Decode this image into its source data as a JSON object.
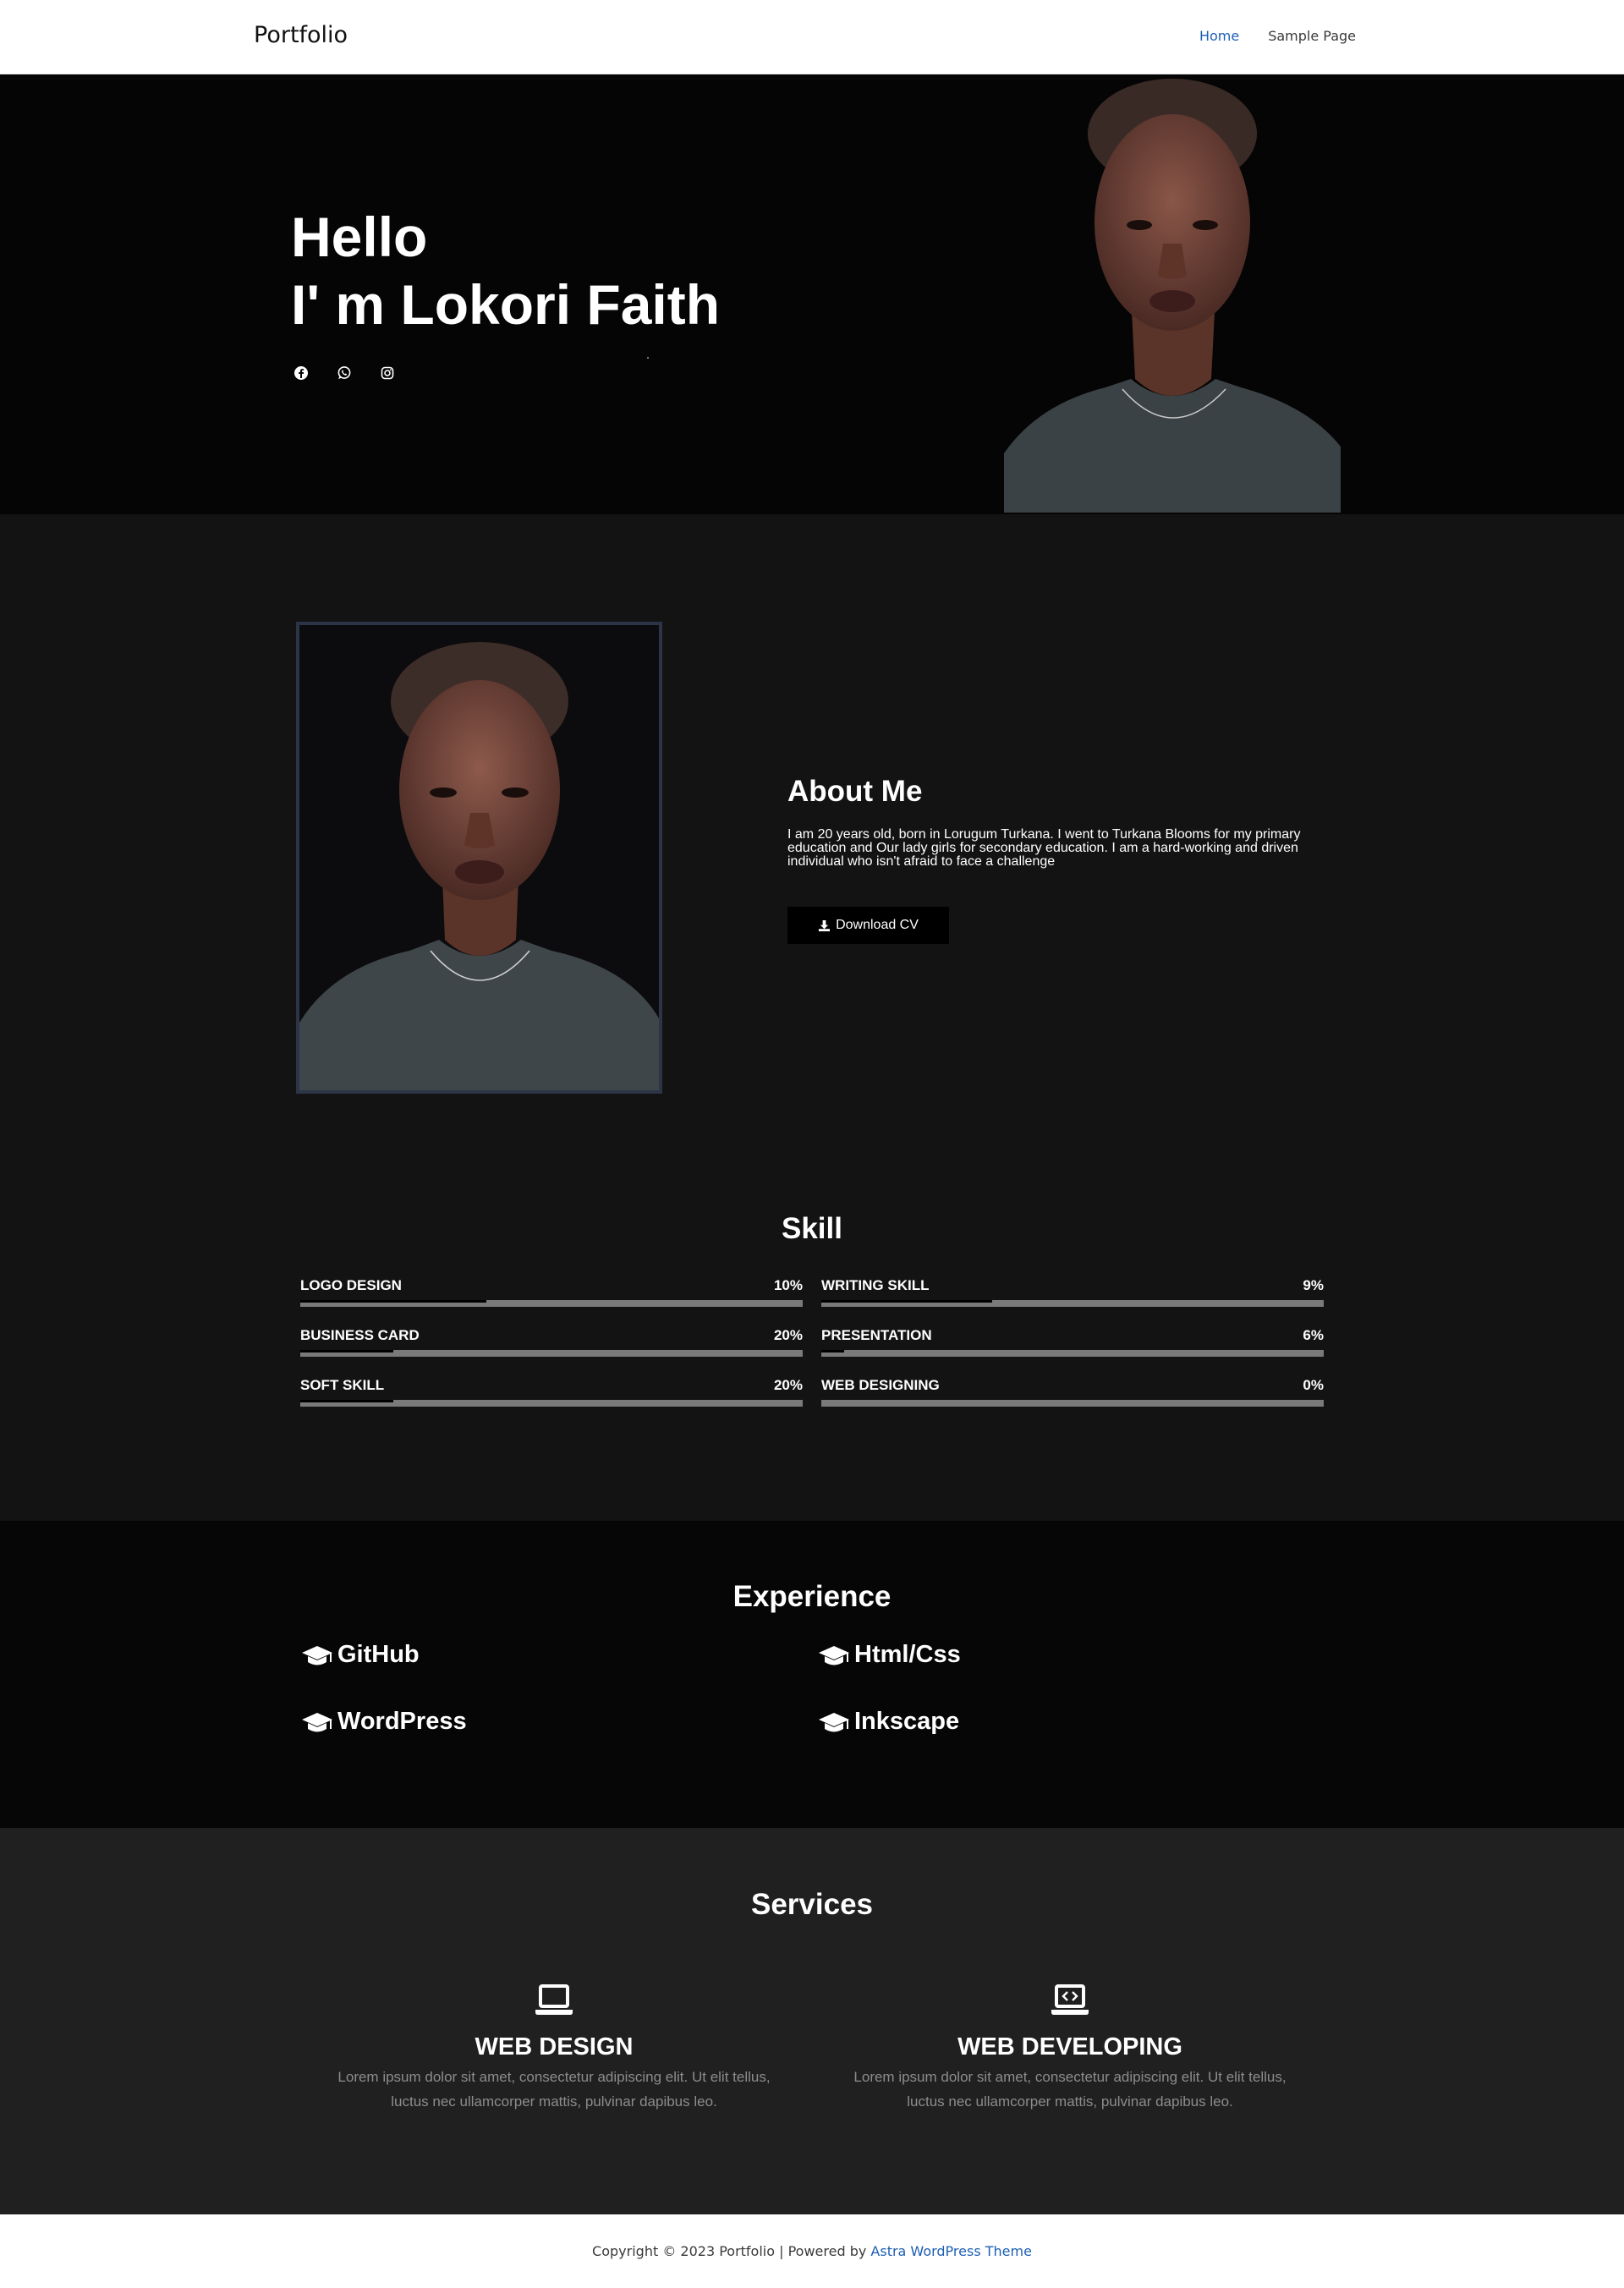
{
  "header": {
    "site_title": "Portfolio",
    "nav": [
      {
        "label": "Home",
        "active": true
      },
      {
        "label": "Sample Page",
        "active": false
      }
    ]
  },
  "hero": {
    "greeting": "Hello",
    "name_line": "I' m Lokori Faith",
    "social_icons": [
      "facebook-icon",
      "whatsapp-icon",
      "instagram-icon"
    ]
  },
  "about": {
    "heading": "About Me",
    "text": "I am 20 years old, born in Lorugum Turkana. I went to Turkana Blooms for my primary education and Our lady girls for secondary education. I am a hard-working and driven individual who isn't afraid to face a challenge",
    "cv_button": "Download CV"
  },
  "skills": {
    "heading": "Skill",
    "items": [
      {
        "name": "LOGO DESIGN",
        "percent_label": "10%",
        "bar_fill": 0.37
      },
      {
        "name": "WRITING SKILL",
        "percent_label": "9%",
        "bar_fill": 0.34
      },
      {
        "name": "BUSINESS CARD",
        "percent_label": "20%",
        "bar_fill": 0.185
      },
      {
        "name": "PRESENTATION",
        "percent_label": "6%",
        "bar_fill": 0.045
      },
      {
        "name": "SOFT SKILL",
        "percent_label": "20%",
        "bar_fill": 0.185
      },
      {
        "name": "WEB DESIGNING",
        "percent_label": "0%",
        "bar_fill": 0
      }
    ]
  },
  "experience": {
    "heading": "Experience",
    "items": [
      "GitHub",
      "Html/Css",
      "WordPress",
      "Inkscape"
    ]
  },
  "services": {
    "heading": "Services",
    "items": [
      {
        "title": "WEB DESIGN",
        "icon": "laptop-icon",
        "desc": "Lorem ipsum dolor sit amet, consectetur adipiscing elit. Ut elit tellus, luctus nec ullamcorper mattis, pulvinar dapibus leo."
      },
      {
        "title": "WEB DEVELOPING",
        "icon": "laptop-code-icon",
        "desc": "Lorem ipsum dolor sit amet, consectetur adipiscing elit. Ut elit tellus, luctus nec ullamcorper mattis, pulvinar dapibus leo."
      }
    ]
  },
  "footer": {
    "prefix": "Copyright © 2023 Portfolio | Powered by ",
    "link": "Astra WordPress Theme"
  },
  "colors": {
    "link": "#1e5fb4",
    "hero_bg": "#050505",
    "about_bg": "#131313",
    "experience_bg": "#060606",
    "services_bg": "#202020",
    "skill_track": "#7a7a7a"
  }
}
